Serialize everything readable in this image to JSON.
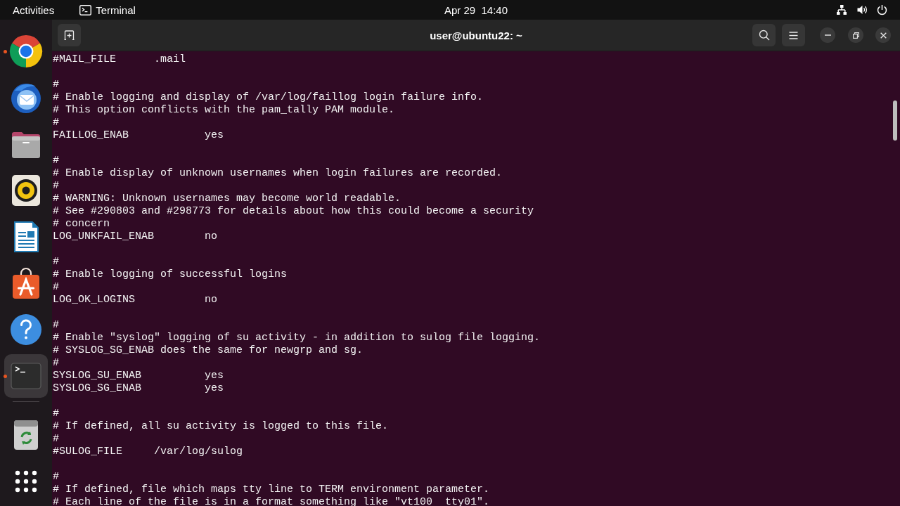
{
  "top_bar": {
    "activities": "Activities",
    "app_menu": "Terminal",
    "clock": "Apr 29  14:40"
  },
  "dock": {
    "favorites": [
      {
        "kind": "browser",
        "running": true,
        "selected": false
      },
      {
        "kind": "mail",
        "running": false,
        "selected": false
      },
      {
        "kind": "files",
        "running": false,
        "selected": false
      },
      {
        "kind": "music",
        "running": false,
        "selected": false
      },
      {
        "kind": "writer",
        "running": false,
        "selected": false
      },
      {
        "kind": "software",
        "running": false,
        "selected": false
      },
      {
        "kind": "help",
        "running": false,
        "selected": false
      },
      {
        "kind": "terminal",
        "running": true,
        "selected": true
      }
    ],
    "volumes": [
      {
        "kind": "trash",
        "running": false,
        "selected": false
      }
    ]
  },
  "terminal": {
    "title": "user@ubuntu22: ~",
    "blocks": [
      [
        "#MAIL_FILE      .mail"
      ],
      [
        "#",
        "# Enable logging and display of /var/log/faillog login failure info.",
        "# This option conflicts with the pam_tally PAM module.",
        "#",
        "FAILLOG_ENAB            yes"
      ],
      [
        "#",
        "# Enable display of unknown usernames when login failures are recorded.",
        "#",
        "# WARNING: Unknown usernames may become world readable.",
        "# See #290803 and #298773 for details about how this could become a security",
        "# concern",
        "LOG_UNKFAIL_ENAB        no"
      ],
      [
        "#",
        "# Enable logging of successful logins",
        "#",
        "LOG_OK_LOGINS           no"
      ],
      [
        "#",
        "# Enable \"syslog\" logging of su activity - in addition to sulog file logging.",
        "# SYSLOG_SG_ENAB does the same for newgrp and sg.",
        "#",
        "SYSLOG_SU_ENAB          yes",
        "SYSLOG_SG_ENAB          yes"
      ],
      [
        "#",
        "# If defined, all su activity is logged to this file.",
        "#",
        "#SULOG_FILE     /var/log/sulog"
      ],
      [
        "#",
        "# If defined, file which maps tty line to TERM environment parameter.",
        "# Each line of the file is in a format something like \"vt100  tty01\"."
      ]
    ]
  }
}
